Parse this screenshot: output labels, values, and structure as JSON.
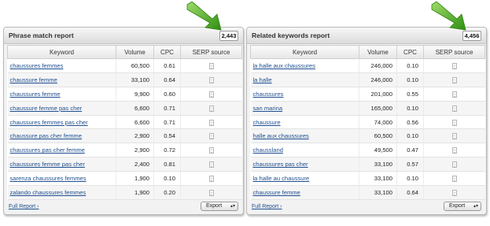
{
  "colors": {
    "arrow_green": "#3fa51a",
    "link_blue": "#1f4f8f"
  },
  "left": {
    "title": "Phrase match report",
    "count": "2,443",
    "columns": [
      "Keyword",
      "Volume",
      "CPC",
      "SERP source"
    ],
    "rows": [
      {
        "keyword": "chaussures femmes",
        "volume": "60,500",
        "cpc": "0.61"
      },
      {
        "keyword": "chaussure femme",
        "volume": "33,100",
        "cpc": "0.64"
      },
      {
        "keyword": "chaussures femme",
        "volume": "9,900",
        "cpc": "0.60"
      },
      {
        "keyword": "chaussure femme pas cher",
        "volume": "6,600",
        "cpc": "0.71"
      },
      {
        "keyword": "chaussures femmes pas cher",
        "volume": "6,600",
        "cpc": "0.71"
      },
      {
        "keyword": "chaussure pas cher femme",
        "volume": "2,900",
        "cpc": "0.54"
      },
      {
        "keyword": "chaussures pas cher femme",
        "volume": "2,900",
        "cpc": "0.72"
      },
      {
        "keyword": "chaussures femme pas cher",
        "volume": "2,400",
        "cpc": "0.81"
      },
      {
        "keyword": "sarenza chaussures femmes",
        "volume": "1,900",
        "cpc": "0.10"
      },
      {
        "keyword": "zalando chaussures femmes",
        "volume": "1,900",
        "cpc": "0.20"
      }
    ],
    "full_report": "Full Report ›",
    "export": "Export"
  },
  "right": {
    "title": "Related keywords report",
    "count": "4,456",
    "columns": [
      "Keyword",
      "Volume",
      "CPC",
      "SERP source"
    ],
    "rows": [
      {
        "keyword": "la halle aux chaussures",
        "volume": "246,000",
        "cpc": "0.10"
      },
      {
        "keyword": "la halle",
        "volume": "246,000",
        "cpc": "0.10"
      },
      {
        "keyword": "chaussures",
        "volume": "201,000",
        "cpc": "0.55"
      },
      {
        "keyword": "san marina",
        "volume": "165,000",
        "cpc": "0.10"
      },
      {
        "keyword": "chaussure",
        "volume": "74,000",
        "cpc": "0.56"
      },
      {
        "keyword": "halle aux chaussures",
        "volume": "60,500",
        "cpc": "0.10"
      },
      {
        "keyword": "chaussland",
        "volume": "49,500",
        "cpc": "0.47"
      },
      {
        "keyword": "chaussures pas cher",
        "volume": "33,100",
        "cpc": "0.57"
      },
      {
        "keyword": "la halle au chaussure",
        "volume": "33,100",
        "cpc": "0.10"
      },
      {
        "keyword": "chaussure femme",
        "volume": "33,100",
        "cpc": "0.64"
      }
    ],
    "full_report": "Full Report ›",
    "export": "Export"
  }
}
